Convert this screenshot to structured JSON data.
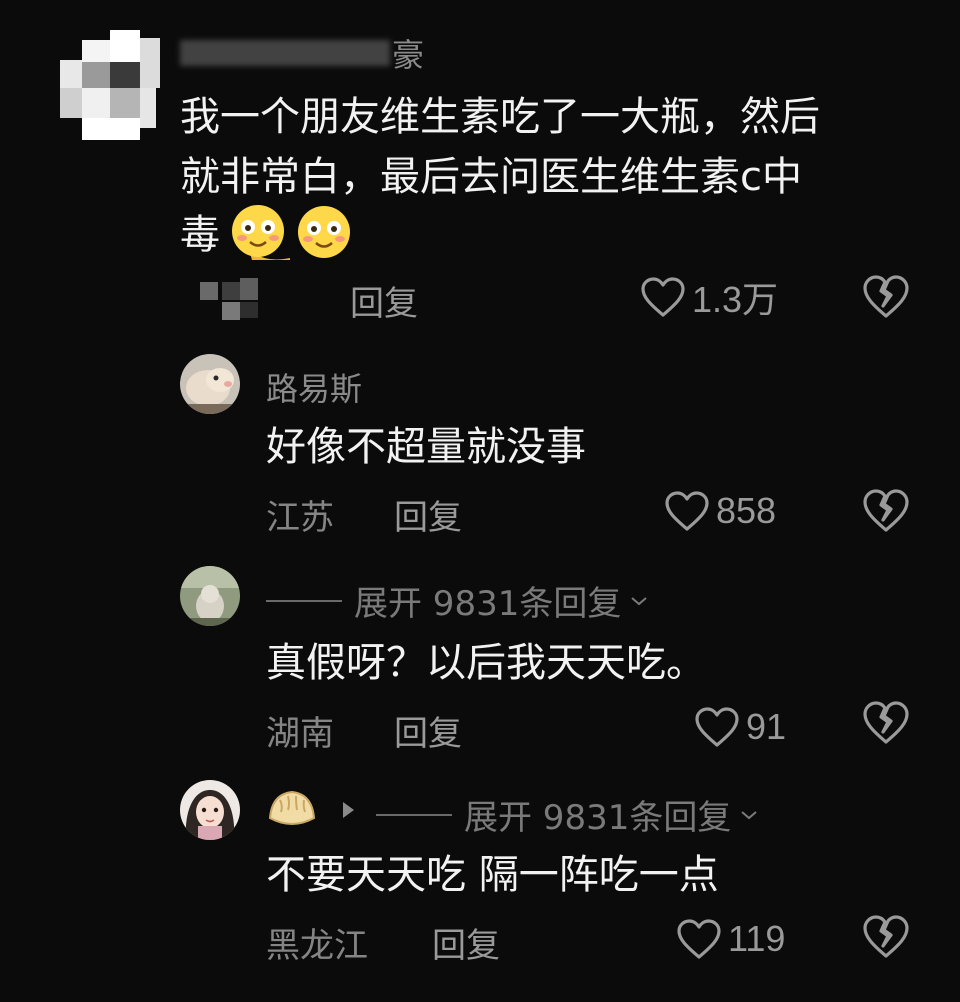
{
  "comments": [
    {
      "name_visible": "豪",
      "text_lines": [
        "我一个朋友维生素吃了一大瓶，然后",
        "就非常白，最后去问医生维生素c中",
        "毒"
      ],
      "emoji_icons": [
        "blush-smile-emoji-icon",
        "blush-smile-emoji-icon"
      ],
      "reply_label": "回复",
      "likes": "1.3万"
    },
    {
      "name": "路易斯",
      "text": "好像不超量就没事",
      "location": "江苏",
      "reply_label": "回复",
      "likes": "858"
    },
    {
      "expand_label": "展开 9831条回复",
      "text": "真假呀？以后我天天吃。",
      "location": "湖南",
      "reply_label": "回复",
      "likes": "91"
    },
    {
      "expand_label": "展开 9831条回复",
      "name_icon": "dumpling-emoji-icon",
      "text": "不要天天吃 隔一阵吃一点",
      "location": "黑龙江",
      "reply_label": "回复",
      "likes": "119"
    }
  ],
  "colors": {
    "background": "#0b0b0b",
    "text": "#f2f2f2",
    "muted": "#858585"
  }
}
